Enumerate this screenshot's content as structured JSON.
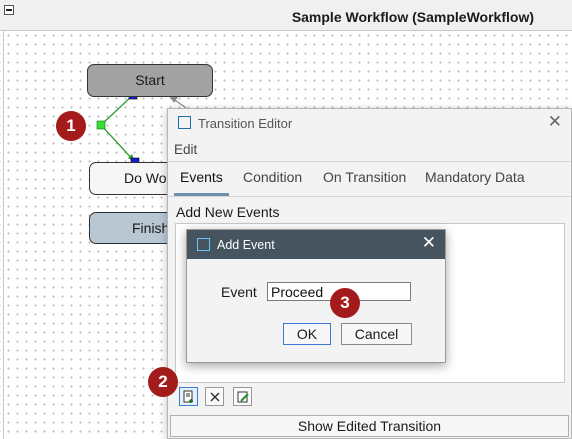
{
  "workflow": {
    "title": "Sample Workflow (SampleWorkflow)",
    "nodes": {
      "start": "Start",
      "do_work": "Do Wo",
      "finish": "Finish"
    }
  },
  "callouts": [
    "1",
    "2",
    "3"
  ],
  "transition_editor": {
    "title": "Transition Editor",
    "menu": "Edit",
    "tabs": [
      "Events",
      "Condition",
      "On Transition",
      "Mandatory Data"
    ],
    "active_tab": "Events",
    "section_label": "Add New Events",
    "toolbar": [
      "add-event-icon",
      "delete-event-icon",
      "edit-event-icon"
    ],
    "show_button": "Show Edited Transition"
  },
  "add_event_dialog": {
    "title": "Add Event",
    "field_label": "Event",
    "field_value": "Proceed",
    "ok_label": "OK",
    "cancel_label": "Cancel"
  },
  "colors": {
    "accent": "#3b78d8",
    "callout": "#a31b1b",
    "dialog_titlebar": "#45545f",
    "start_node": "#a2a2a2",
    "finish_node": "#b9c7d3",
    "edge": "#2e9e2e"
  }
}
